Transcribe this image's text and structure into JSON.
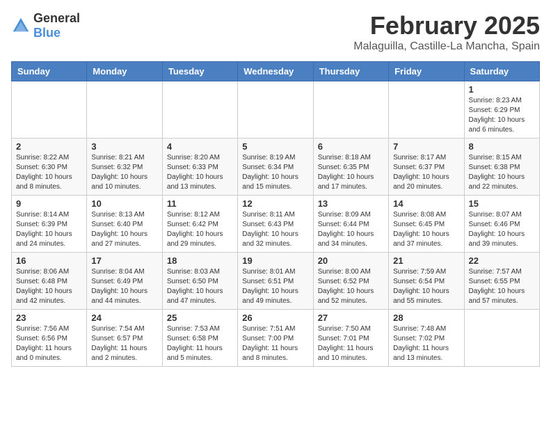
{
  "header": {
    "logo_general": "General",
    "logo_blue": "Blue",
    "month_title": "February 2025",
    "location": "Malaguilla, Castille-La Mancha, Spain"
  },
  "weekdays": [
    "Sunday",
    "Monday",
    "Tuesday",
    "Wednesday",
    "Thursday",
    "Friday",
    "Saturday"
  ],
  "weeks": [
    [
      {
        "day": "",
        "info": ""
      },
      {
        "day": "",
        "info": ""
      },
      {
        "day": "",
        "info": ""
      },
      {
        "day": "",
        "info": ""
      },
      {
        "day": "",
        "info": ""
      },
      {
        "day": "",
        "info": ""
      },
      {
        "day": "1",
        "info": "Sunrise: 8:23 AM\nSunset: 6:29 PM\nDaylight: 10 hours and 6 minutes."
      }
    ],
    [
      {
        "day": "2",
        "info": "Sunrise: 8:22 AM\nSunset: 6:30 PM\nDaylight: 10 hours and 8 minutes."
      },
      {
        "day": "3",
        "info": "Sunrise: 8:21 AM\nSunset: 6:32 PM\nDaylight: 10 hours and 10 minutes."
      },
      {
        "day": "4",
        "info": "Sunrise: 8:20 AM\nSunset: 6:33 PM\nDaylight: 10 hours and 13 minutes."
      },
      {
        "day": "5",
        "info": "Sunrise: 8:19 AM\nSunset: 6:34 PM\nDaylight: 10 hours and 15 minutes."
      },
      {
        "day": "6",
        "info": "Sunrise: 8:18 AM\nSunset: 6:35 PM\nDaylight: 10 hours and 17 minutes."
      },
      {
        "day": "7",
        "info": "Sunrise: 8:17 AM\nSunset: 6:37 PM\nDaylight: 10 hours and 20 minutes."
      },
      {
        "day": "8",
        "info": "Sunrise: 8:15 AM\nSunset: 6:38 PM\nDaylight: 10 hours and 22 minutes."
      }
    ],
    [
      {
        "day": "9",
        "info": "Sunrise: 8:14 AM\nSunset: 6:39 PM\nDaylight: 10 hours and 24 minutes."
      },
      {
        "day": "10",
        "info": "Sunrise: 8:13 AM\nSunset: 6:40 PM\nDaylight: 10 hours and 27 minutes."
      },
      {
        "day": "11",
        "info": "Sunrise: 8:12 AM\nSunset: 6:42 PM\nDaylight: 10 hours and 29 minutes."
      },
      {
        "day": "12",
        "info": "Sunrise: 8:11 AM\nSunset: 6:43 PM\nDaylight: 10 hours and 32 minutes."
      },
      {
        "day": "13",
        "info": "Sunrise: 8:09 AM\nSunset: 6:44 PM\nDaylight: 10 hours and 34 minutes."
      },
      {
        "day": "14",
        "info": "Sunrise: 8:08 AM\nSunset: 6:45 PM\nDaylight: 10 hours and 37 minutes."
      },
      {
        "day": "15",
        "info": "Sunrise: 8:07 AM\nSunset: 6:46 PM\nDaylight: 10 hours and 39 minutes."
      }
    ],
    [
      {
        "day": "16",
        "info": "Sunrise: 8:06 AM\nSunset: 6:48 PM\nDaylight: 10 hours and 42 minutes."
      },
      {
        "day": "17",
        "info": "Sunrise: 8:04 AM\nSunset: 6:49 PM\nDaylight: 10 hours and 44 minutes."
      },
      {
        "day": "18",
        "info": "Sunrise: 8:03 AM\nSunset: 6:50 PM\nDaylight: 10 hours and 47 minutes."
      },
      {
        "day": "19",
        "info": "Sunrise: 8:01 AM\nSunset: 6:51 PM\nDaylight: 10 hours and 49 minutes."
      },
      {
        "day": "20",
        "info": "Sunrise: 8:00 AM\nSunset: 6:52 PM\nDaylight: 10 hours and 52 minutes."
      },
      {
        "day": "21",
        "info": "Sunrise: 7:59 AM\nSunset: 6:54 PM\nDaylight: 10 hours and 55 minutes."
      },
      {
        "day": "22",
        "info": "Sunrise: 7:57 AM\nSunset: 6:55 PM\nDaylight: 10 hours and 57 minutes."
      }
    ],
    [
      {
        "day": "23",
        "info": "Sunrise: 7:56 AM\nSunset: 6:56 PM\nDaylight: 11 hours and 0 minutes."
      },
      {
        "day": "24",
        "info": "Sunrise: 7:54 AM\nSunset: 6:57 PM\nDaylight: 11 hours and 2 minutes."
      },
      {
        "day": "25",
        "info": "Sunrise: 7:53 AM\nSunset: 6:58 PM\nDaylight: 11 hours and 5 minutes."
      },
      {
        "day": "26",
        "info": "Sunrise: 7:51 AM\nSunset: 7:00 PM\nDaylight: 11 hours and 8 minutes."
      },
      {
        "day": "27",
        "info": "Sunrise: 7:50 AM\nSunset: 7:01 PM\nDaylight: 11 hours and 10 minutes."
      },
      {
        "day": "28",
        "info": "Sunrise: 7:48 AM\nSunset: 7:02 PM\nDaylight: 11 hours and 13 minutes."
      },
      {
        "day": "",
        "info": ""
      }
    ]
  ]
}
